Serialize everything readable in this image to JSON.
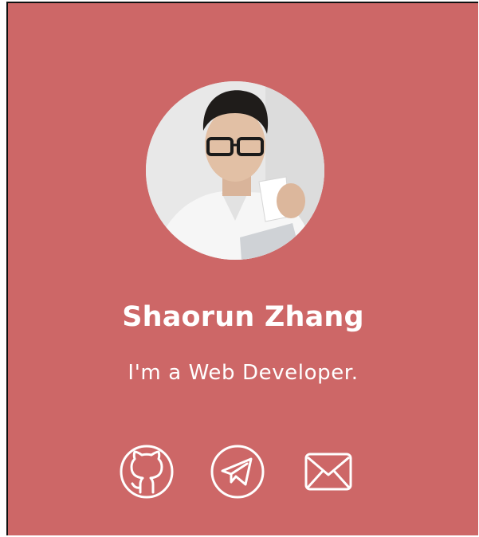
{
  "profile": {
    "name": "Shaorun Zhang",
    "role": "I'm a Web Developer."
  },
  "social": [
    {
      "icon": "github-icon"
    },
    {
      "icon": "telegram-icon"
    },
    {
      "icon": "mail-icon"
    }
  ],
  "colors": {
    "background": "#cd6767",
    "text": "#ffffff",
    "border": "#111111"
  }
}
